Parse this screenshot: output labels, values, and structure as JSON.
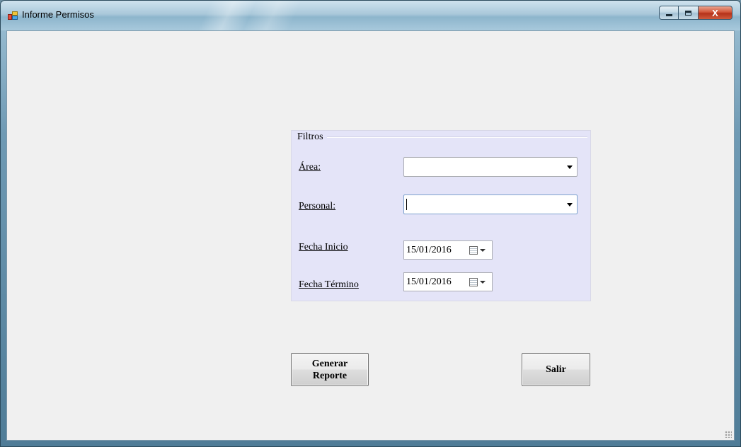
{
  "window": {
    "title": "Informe Permisos",
    "close_glyph": "X"
  },
  "filters": {
    "group_title": "Filtros",
    "area_label": "Área:",
    "area_value": "",
    "personal_label": "Personal:",
    "personal_value": "",
    "fecha_inicio_label": "Fecha Inicio",
    "fecha_inicio_value": "15/01/2016",
    "fecha_termino_label": "Fecha Término",
    "fecha_termino_value": "15/01/2016"
  },
  "actions": {
    "generar_line1": "Generar",
    "generar_line2": "Reporte",
    "salir": "Salir"
  },
  "icons": {
    "app": "app-icon",
    "calendar": "calendar-icon",
    "dropdown": "chevron-down-icon"
  },
  "colors": {
    "groupbox_bg": "#e4e4f8",
    "client_bg": "#f0f0f0",
    "close_button": "#c7472d"
  }
}
